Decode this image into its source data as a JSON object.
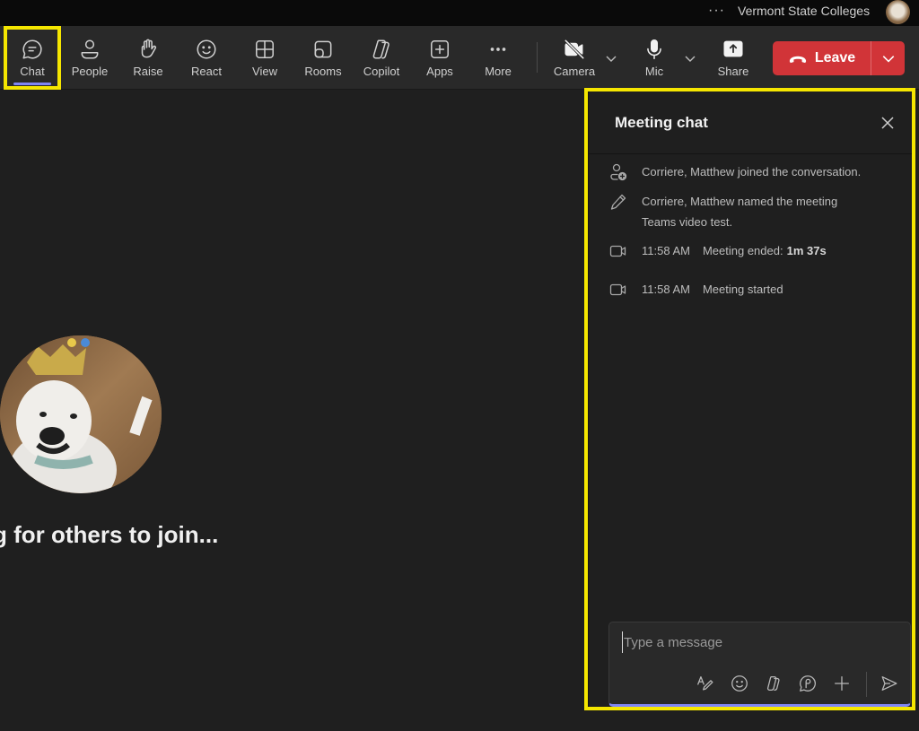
{
  "titlebar": {
    "more_label": "···",
    "organization": "Vermont State Colleges"
  },
  "toolbar": {
    "items": [
      {
        "id": "chat",
        "label": "Chat",
        "icon": "chat-icon",
        "active": true
      },
      {
        "id": "people",
        "label": "People",
        "icon": "people-icon"
      },
      {
        "id": "raise",
        "label": "Raise",
        "icon": "raise-hand-icon"
      },
      {
        "id": "react",
        "label": "React",
        "icon": "smiley-icon"
      },
      {
        "id": "view",
        "label": "View",
        "icon": "grid-view-icon"
      },
      {
        "id": "rooms",
        "label": "Rooms",
        "icon": "rooms-icon"
      },
      {
        "id": "copilot",
        "label": "Copilot",
        "icon": "copilot-icon"
      },
      {
        "id": "apps",
        "label": "Apps",
        "icon": "apps-plus-icon"
      },
      {
        "id": "more",
        "label": "More",
        "icon": "more-icon"
      }
    ],
    "camera_label": "Camera",
    "mic_label": "Mic",
    "share_label": "Share",
    "leave_label": "Leave",
    "leave_color": "#d13438",
    "highlight_color": "#f5e600",
    "accent_color": "#7f85f5"
  },
  "stage": {
    "waiting_text": "g for others to join..."
  },
  "chat_panel": {
    "title": "Meeting chat",
    "events": [
      {
        "icon": "person-add-icon",
        "text": "Corriere, Matthew joined the conversation."
      },
      {
        "icon": "pencil-icon",
        "text_line1": "Corriere, Matthew named the meeting",
        "text_line2": "Teams video test."
      },
      {
        "icon": "video-camera-icon",
        "time": "11:58 AM",
        "text": "Meeting ended: ",
        "bold": "1m 37s"
      },
      {
        "icon": "video-camera-icon",
        "time": "11:58 AM",
        "text": "Meeting started"
      }
    ],
    "composer": {
      "placeholder": "Type a message",
      "value": ""
    }
  }
}
